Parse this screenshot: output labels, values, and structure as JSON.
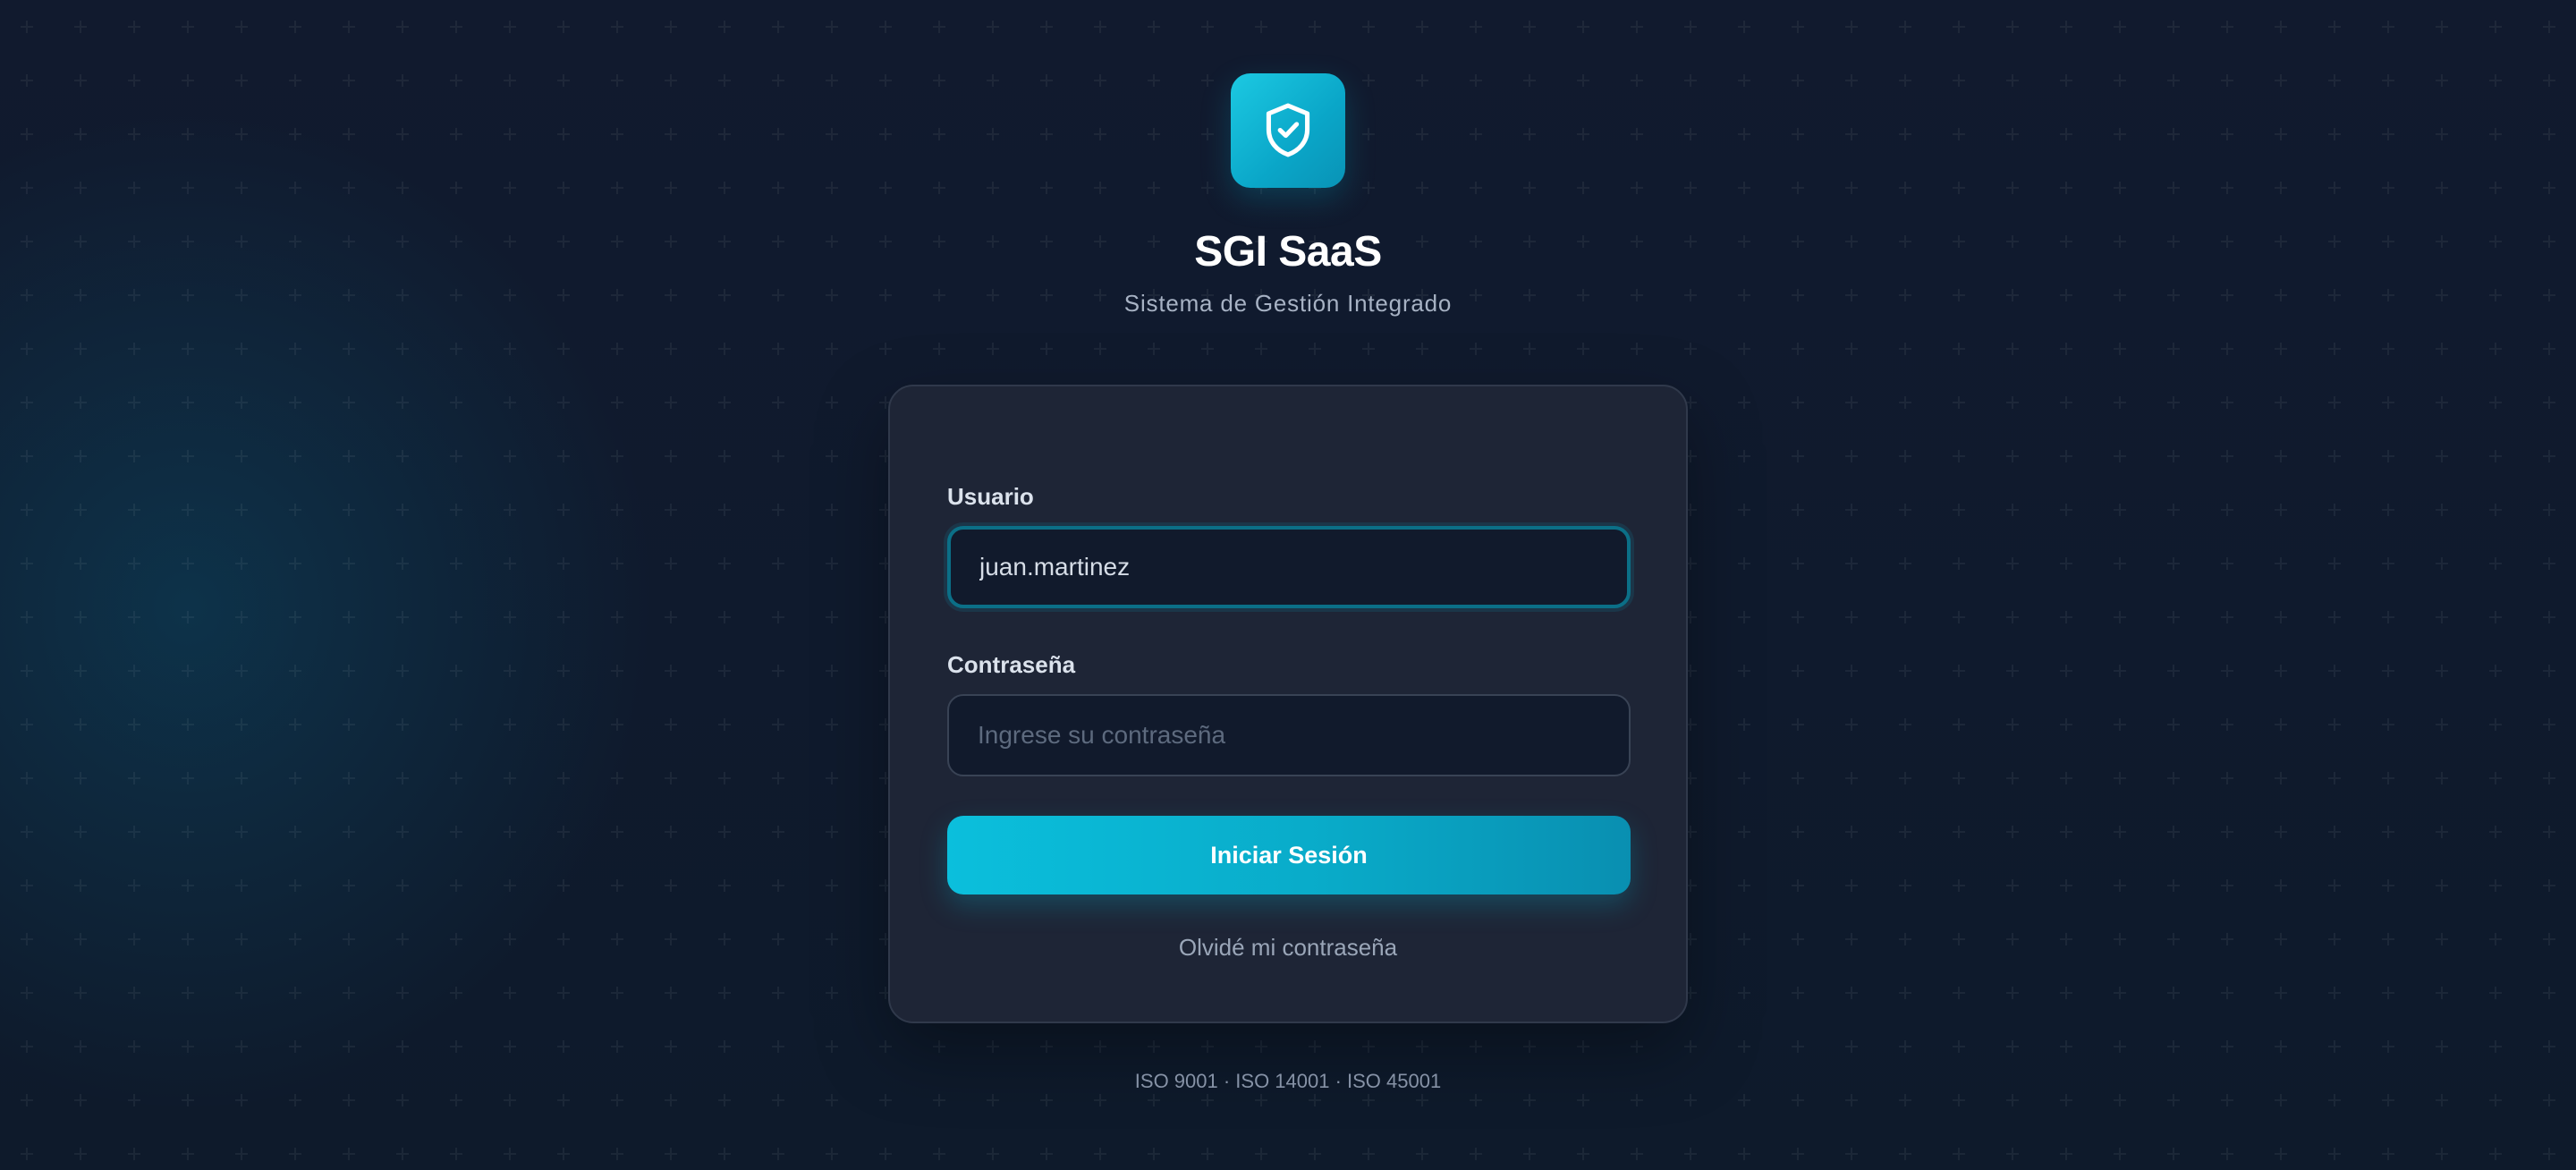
{
  "brand": {
    "logo_icon": "shield-check-icon",
    "title": "SGI SaaS",
    "subtitle": "Sistema de Gestión Integrado"
  },
  "login_form": {
    "username": {
      "label": "Usuario",
      "value": "juan.martinez"
    },
    "password": {
      "label": "Contraseña",
      "placeholder": "Ingrese su contraseña",
      "value": ""
    },
    "submit_label": "Iniciar Sesión",
    "forgot_password_label": "Olvidé mi contraseña"
  },
  "footer": {
    "standards": "ISO 9001 · ISO 14001 · ISO 45001"
  },
  "colors": {
    "accent": "#06b6d4",
    "background": "#0f1a2c",
    "card": "#1e2536"
  }
}
